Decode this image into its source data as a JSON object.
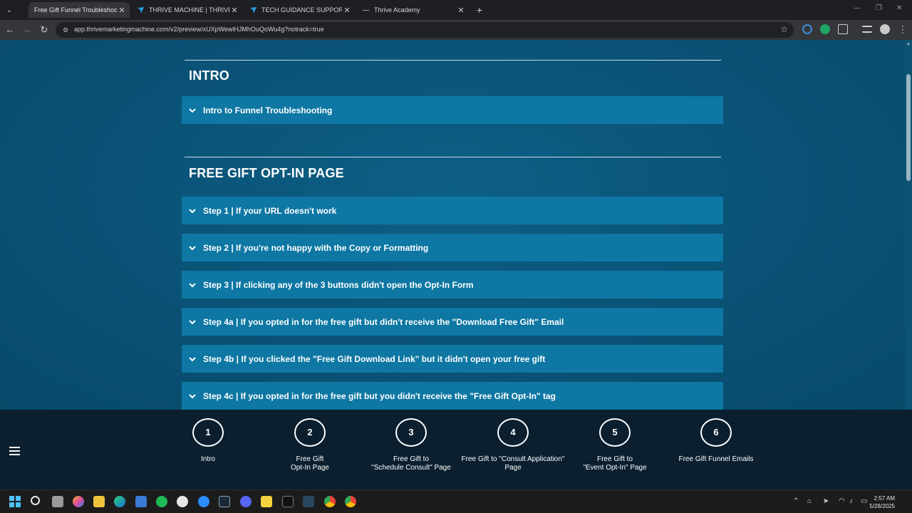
{
  "browser": {
    "tabs": [
      {
        "title": "Free Gift Funnel Troubleshootin",
        "active": true
      },
      {
        "title": "THRIVE MACHINE | THRIVE ACAD",
        "active": false
      },
      {
        "title": "TECH GUIDANCE SUPPORT BOA",
        "active": false
      },
      {
        "title": "Thrive Academy",
        "active": false
      }
    ],
    "url": "app.thrivemarketingmachine.com/v2/preview/xUXpWewlHJMhOuQoWu4g?notrack=true"
  },
  "sections": [
    {
      "title": "INTRO",
      "items": [
        "Intro to Funnel Troubleshooting"
      ]
    },
    {
      "title": "FREE GIFT OPT-IN PAGE",
      "items": [
        "Step 1 | If your URL doesn't work",
        "Step 2 | If you're not happy with the Copy or Formatting",
        "Step 3 | If clicking any of the 3 buttons didn't open the Opt-In Form",
        "Step 4a | If you opted in for the free gift but didn't receive the \"Download Free Gift\" Email",
        "Step 4b | If you clicked the \"Free Gift Download Link\" but it didn't open your free gift",
        "Step 4c | If you opted in for the free gift but you didn't receive the \"Free Gift Opt-In\" tag"
      ]
    }
  ],
  "steps": [
    {
      "number": "1",
      "caption": "Intro"
    },
    {
      "number": "2",
      "caption": "Free Gift\nOpt-In Page"
    },
    {
      "number": "3",
      "caption": "Free Gift to\n\"Schedule Consult\" Page"
    },
    {
      "number": "4",
      "caption": "Free Gift to \"Consult Application\"\nPage"
    },
    {
      "number": "5",
      "caption": "Free Gift to\n\"Event Opt-In\" Page"
    },
    {
      "number": "6",
      "caption": "Free Gift Funnel Emails"
    }
  ],
  "taskbar": {
    "time": "2:57 AM",
    "date": "5/28/2025"
  },
  "colors": {
    "page_bg": "#0a5478",
    "accordion_bg": "#0e77a3",
    "stepnav_bg": "#0b1f2e"
  }
}
